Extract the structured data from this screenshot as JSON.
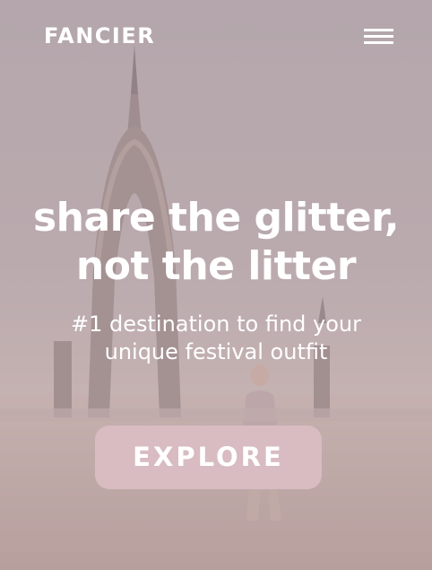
{
  "header": {
    "logo_text": "FANCIER",
    "menu_icon": "hamburger-menu-icon"
  },
  "hero": {
    "headline_line1": "share the glitter,",
    "headline_line2": "not the litter",
    "subheadline_line1": "#1 destination to find your",
    "subheadline_line2": "unique festival outfit",
    "cta_label": "EXPLORE",
    "cta_color": "#d8bcc1"
  }
}
